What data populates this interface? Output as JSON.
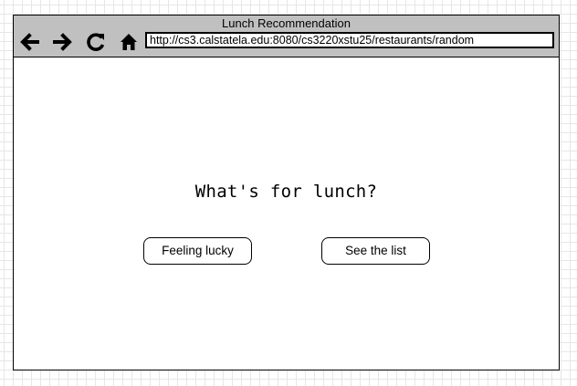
{
  "window": {
    "title": "Lunch Recommendation"
  },
  "toolbar": {
    "back_icon": "arrow-left-icon",
    "forward_icon": "arrow-right-icon",
    "reload_icon": "reload-icon",
    "home_icon": "home-icon",
    "url": "http://cs3.calstatela.edu:8080/cs3220xstu25/restaurants/random"
  },
  "main": {
    "headline": "What's for lunch?",
    "feeling_lucky_label": "Feeling lucky",
    "see_list_label": "See the list"
  }
}
